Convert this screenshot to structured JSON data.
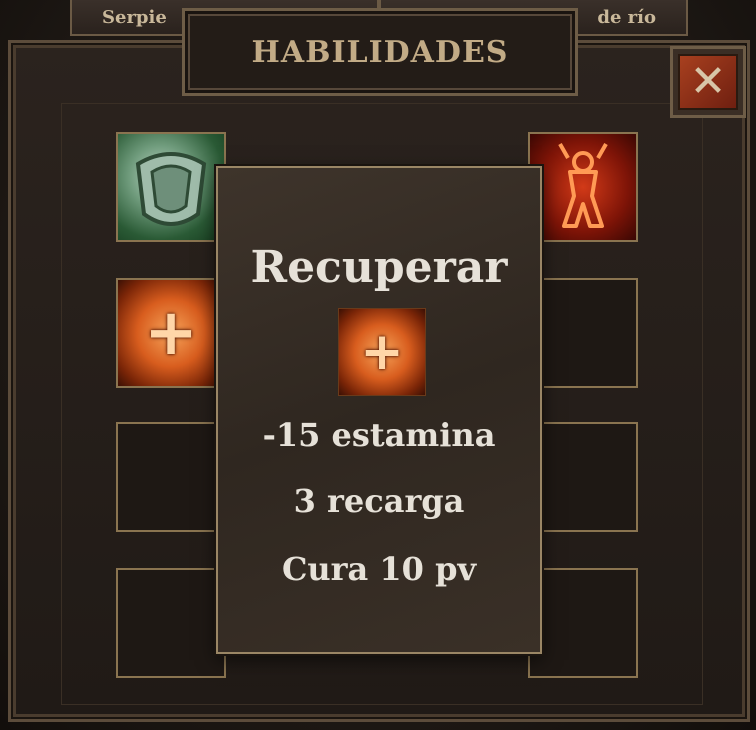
{
  "top_tabs": {
    "left_label": "Serpie",
    "right_label": "de río"
  },
  "header": {
    "title": "HABILIDADES"
  },
  "close": {
    "symbol": "✕",
    "icon": "close-icon"
  },
  "skills": {
    "slot_1": {
      "icon": "shield-skill-icon"
    },
    "slot_2": {
      "icon": "rage-skill-icon"
    },
    "slot_3": {
      "icon": "heal-skill-icon",
      "glyph": "+"
    }
  },
  "tooltip": {
    "title": "Recuperar",
    "icon": "heal-skill-icon",
    "glyph": "+",
    "cost": "-15 estamina",
    "cooldown": "3 recarga",
    "effect": "Cura 10 pv"
  },
  "colors": {
    "frame": "#8a7450",
    "text": "#e6e1d8",
    "header_text": "#c2ab86",
    "close_red": "#a8401f"
  }
}
